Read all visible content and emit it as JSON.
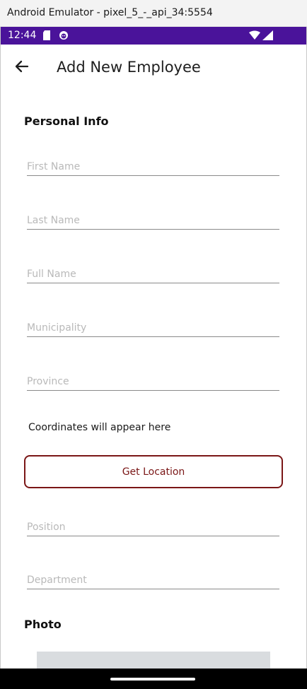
{
  "window": {
    "title": "Android Emulator - pixel_5_-_api_34:5554"
  },
  "status_bar": {
    "time": "12:44",
    "icons": [
      "sd-card-icon",
      "face-icon",
      "wifi-icon",
      "signal-icon"
    ],
    "background_color": "#4a139a"
  },
  "app_bar": {
    "title": "Add New Employee",
    "back_icon": "arrow-left-icon"
  },
  "personal_info": {
    "heading": "Personal Info",
    "fields": {
      "first_name": {
        "placeholder": "First Name",
        "value": ""
      },
      "last_name": {
        "placeholder": "Last Name",
        "value": ""
      },
      "full_name": {
        "placeholder": "Full Name",
        "value": ""
      },
      "municipality": {
        "placeholder": "Municipality",
        "value": ""
      },
      "province": {
        "placeholder": "Province",
        "value": ""
      }
    },
    "coordinates_text": "Coordinates will appear here",
    "get_location_label": "Get Location",
    "position": {
      "placeholder": "Position",
      "value": ""
    },
    "department": {
      "placeholder": "Department",
      "value": ""
    }
  },
  "photo": {
    "heading": "Photo"
  },
  "colors": {
    "accent": "#7a1616",
    "field_underline": "#8a8a8a",
    "placeholder": "#b9b9b9"
  }
}
